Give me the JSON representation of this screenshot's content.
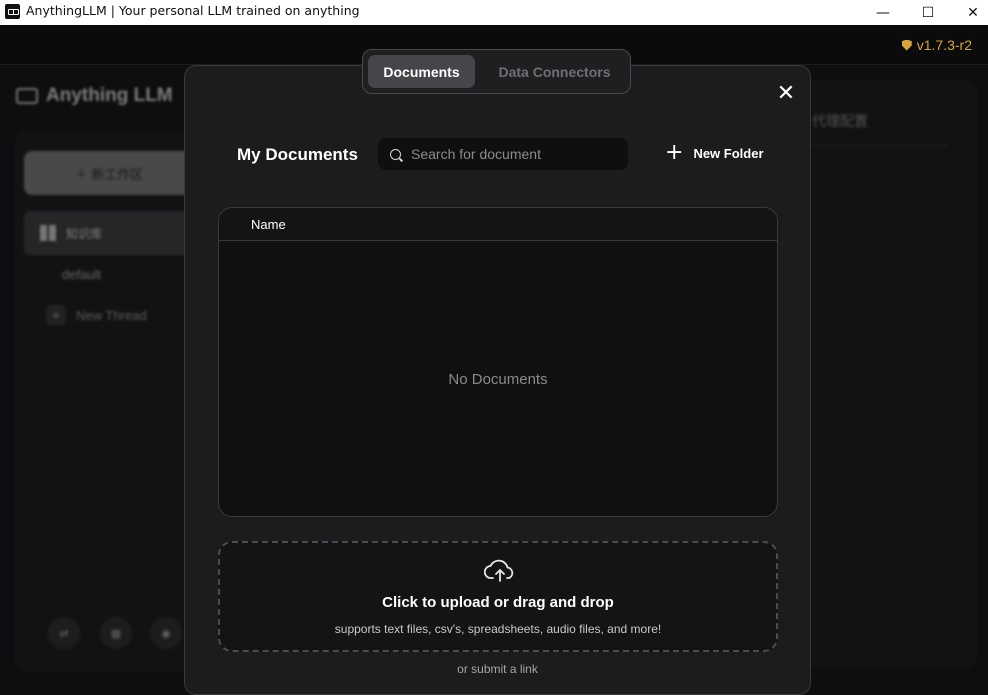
{
  "window": {
    "title": "AnythingLLM | Your personal LLM trained on anything",
    "minimize_glyph": "—",
    "maximize_glyph": "☐",
    "close_glyph": "✕"
  },
  "appbar": {
    "version": "v1.7.3-r2",
    "accent_color": "#d8a33a"
  },
  "background": {
    "logo_text": "Anything LLM",
    "new_workspace_label": "新工作区",
    "workspace_name": "知识库",
    "thread_name": "default",
    "new_thread_label": "New Thread",
    "right_panel_text": "代理配置",
    "footer_icons": [
      "community-icon",
      "docs-icon",
      "discord-icon"
    ]
  },
  "modal": {
    "tabs": [
      {
        "label": "Documents",
        "active": true
      },
      {
        "label": "Data Connectors",
        "active": false
      }
    ],
    "close_glyph": "✕",
    "heading": "My Documents",
    "search_placeholder": "Search for document",
    "new_folder_label": "New Folder",
    "table": {
      "columns": [
        "Name"
      ],
      "empty_text": "No Documents"
    },
    "upload": {
      "title": "Click to upload or drag and drop",
      "subtitle": "supports text files, csv's, spreadsheets, audio files, and more!"
    },
    "submit_link": "or submit a link"
  }
}
